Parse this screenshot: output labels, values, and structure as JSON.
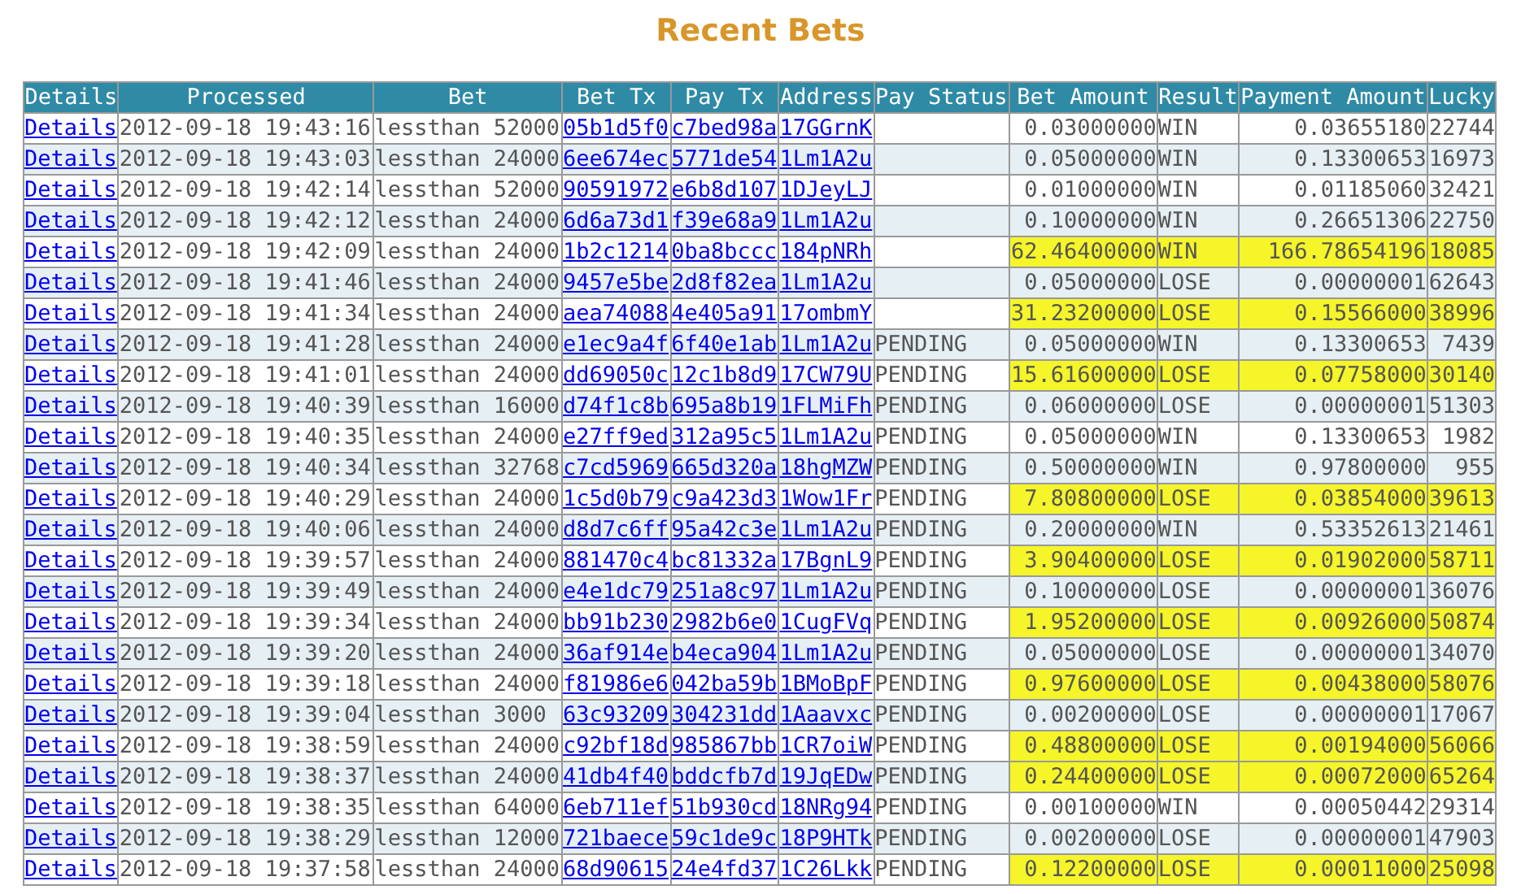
{
  "title": "Recent Bets",
  "table": {
    "columns": [
      "Details",
      "Processed",
      "Bet",
      "Bet Tx",
      "Pay Tx",
      "Address",
      "Pay Status",
      "Bet Amount",
      "Result",
      "Payment Amount",
      "Lucky"
    ],
    "rows": [
      {
        "details": "Details",
        "processed": "2012-09-18 19:43:16",
        "bet": "lessthan 52000",
        "bet_tx": "05b1d5f0",
        "pay_tx": "c7bed98a",
        "address": "17GGrnK",
        "pay_status": "",
        "bet_amount": "0.03000000",
        "result": "WIN",
        "payment_amount": "0.03655180",
        "lucky": "22744",
        "highlighted": false
      },
      {
        "details": "Details",
        "processed": "2012-09-18 19:43:03",
        "bet": "lessthan 24000",
        "bet_tx": "6ee674ec",
        "pay_tx": "5771de54",
        "address": "1Lm1A2u",
        "pay_status": "",
        "bet_amount": "0.05000000",
        "result": "WIN",
        "payment_amount": "0.13300653",
        "lucky": "16973",
        "highlighted": false
      },
      {
        "details": "Details",
        "processed": "2012-09-18 19:42:14",
        "bet": "lessthan 52000",
        "bet_tx": "90591972",
        "pay_tx": "e6b8d107",
        "address": "1DJeyLJ",
        "pay_status": "",
        "bet_amount": "0.01000000",
        "result": "WIN",
        "payment_amount": "0.01185060",
        "lucky": "32421",
        "highlighted": false
      },
      {
        "details": "Details",
        "processed": "2012-09-18 19:42:12",
        "bet": "lessthan 24000",
        "bet_tx": "6d6a73d1",
        "pay_tx": "f39e68a9",
        "address": "1Lm1A2u",
        "pay_status": "",
        "bet_amount": "0.10000000",
        "result": "WIN",
        "payment_amount": "0.26651306",
        "lucky": "22750",
        "highlighted": false
      },
      {
        "details": "Details",
        "processed": "2012-09-18 19:42:09",
        "bet": "lessthan 24000",
        "bet_tx": "1b2c1214",
        "pay_tx": "0ba8bccc",
        "address": "184pNRh",
        "pay_status": "",
        "bet_amount": "62.46400000",
        "result": "WIN",
        "payment_amount": "166.78654196",
        "lucky": "18085",
        "highlighted": true
      },
      {
        "details": "Details",
        "processed": "2012-09-18 19:41:46",
        "bet": "lessthan 24000",
        "bet_tx": "9457e5be",
        "pay_tx": "2d8f82ea",
        "address": "1Lm1A2u",
        "pay_status": "",
        "bet_amount": "0.05000000",
        "result": "LOSE",
        "payment_amount": "0.00000001",
        "lucky": "62643",
        "highlighted": false
      },
      {
        "details": "Details",
        "processed": "2012-09-18 19:41:34",
        "bet": "lessthan 24000",
        "bet_tx": "aea74088",
        "pay_tx": "4e405a91",
        "address": "17ombmY",
        "pay_status": "",
        "bet_amount": "31.23200000",
        "result": "LOSE",
        "payment_amount": "0.15566000",
        "lucky": "38996",
        "highlighted": true
      },
      {
        "details": "Details",
        "processed": "2012-09-18 19:41:28",
        "bet": "lessthan 24000",
        "bet_tx": "e1ec9a4f",
        "pay_tx": "6f40e1ab",
        "address": "1Lm1A2u",
        "pay_status": "PENDING",
        "bet_amount": "0.05000000",
        "result": "WIN",
        "payment_amount": "0.13300653",
        "lucky": "7439",
        "highlighted": false
      },
      {
        "details": "Details",
        "processed": "2012-09-18 19:41:01",
        "bet": "lessthan 24000",
        "bet_tx": "dd69050c",
        "pay_tx": "12c1b8d9",
        "address": "17CW79U",
        "pay_status": "PENDING",
        "bet_amount": "15.61600000",
        "result": "LOSE",
        "payment_amount": "0.07758000",
        "lucky": "30140",
        "highlighted": true
      },
      {
        "details": "Details",
        "processed": "2012-09-18 19:40:39",
        "bet": "lessthan 16000",
        "bet_tx": "d74f1c8b",
        "pay_tx": "695a8b19",
        "address": "1FLMiFh",
        "pay_status": "PENDING",
        "bet_amount": "0.06000000",
        "result": "LOSE",
        "payment_amount": "0.00000001",
        "lucky": "51303",
        "highlighted": false
      },
      {
        "details": "Details",
        "processed": "2012-09-18 19:40:35",
        "bet": "lessthan 24000",
        "bet_tx": "e27ff9ed",
        "pay_tx": "312a95c5",
        "address": "1Lm1A2u",
        "pay_status": "PENDING",
        "bet_amount": "0.05000000",
        "result": "WIN",
        "payment_amount": "0.13300653",
        "lucky": "1982",
        "highlighted": false
      },
      {
        "details": "Details",
        "processed": "2012-09-18 19:40:34",
        "bet": "lessthan 32768",
        "bet_tx": "c7cd5969",
        "pay_tx": "665d320a",
        "address": "18hgMZW",
        "pay_status": "PENDING",
        "bet_amount": "0.50000000",
        "result": "WIN",
        "payment_amount": "0.97800000",
        "lucky": "955",
        "highlighted": false
      },
      {
        "details": "Details",
        "processed": "2012-09-18 19:40:29",
        "bet": "lessthan 24000",
        "bet_tx": "1c5d0b79",
        "pay_tx": "c9a423d3",
        "address": "1Wow1Fr",
        "pay_status": "PENDING",
        "bet_amount": "7.80800000",
        "result": "LOSE",
        "payment_amount": "0.03854000",
        "lucky": "39613",
        "highlighted": true
      },
      {
        "details": "Details",
        "processed": "2012-09-18 19:40:06",
        "bet": "lessthan 24000",
        "bet_tx": "d8d7c6ff",
        "pay_tx": "95a42c3e",
        "address": "1Lm1A2u",
        "pay_status": "PENDING",
        "bet_amount": "0.20000000",
        "result": "WIN",
        "payment_amount": "0.53352613",
        "lucky": "21461",
        "highlighted": false
      },
      {
        "details": "Details",
        "processed": "2012-09-18 19:39:57",
        "bet": "lessthan 24000",
        "bet_tx": "881470c4",
        "pay_tx": "bc81332a",
        "address": "17BgnL9",
        "pay_status": "PENDING",
        "bet_amount": "3.90400000",
        "result": "LOSE",
        "payment_amount": "0.01902000",
        "lucky": "58711",
        "highlighted": true
      },
      {
        "details": "Details",
        "processed": "2012-09-18 19:39:49",
        "bet": "lessthan 24000",
        "bet_tx": "e4e1dc79",
        "pay_tx": "251a8c97",
        "address": "1Lm1A2u",
        "pay_status": "PENDING",
        "bet_amount": "0.10000000",
        "result": "LOSE",
        "payment_amount": "0.00000001",
        "lucky": "36076",
        "highlighted": false
      },
      {
        "details": "Details",
        "processed": "2012-09-18 19:39:34",
        "bet": "lessthan 24000",
        "bet_tx": "bb91b230",
        "pay_tx": "2982b6e0",
        "address": "1CugFVq",
        "pay_status": "PENDING",
        "bet_amount": "1.95200000",
        "result": "LOSE",
        "payment_amount": "0.00926000",
        "lucky": "50874",
        "highlighted": true
      },
      {
        "details": "Details",
        "processed": "2012-09-18 19:39:20",
        "bet": "lessthan 24000",
        "bet_tx": "36af914e",
        "pay_tx": "b4eca904",
        "address": "1Lm1A2u",
        "pay_status": "PENDING",
        "bet_amount": "0.05000000",
        "result": "LOSE",
        "payment_amount": "0.00000001",
        "lucky": "34070",
        "highlighted": false
      },
      {
        "details": "Details",
        "processed": "2012-09-18 19:39:18",
        "bet": "lessthan 24000",
        "bet_tx": "f81986e6",
        "pay_tx": "042ba59b",
        "address": "1BMoBpF",
        "pay_status": "PENDING",
        "bet_amount": "0.97600000",
        "result": "LOSE",
        "payment_amount": "0.00438000",
        "lucky": "58076",
        "highlighted": true
      },
      {
        "details": "Details",
        "processed": "2012-09-18 19:39:04",
        "bet": "lessthan 3000",
        "bet_tx": "63c93209",
        "pay_tx": "304231dd",
        "address": "1Aaavxc",
        "pay_status": "PENDING",
        "bet_amount": "0.00200000",
        "result": "LOSE",
        "payment_amount": "0.00000001",
        "lucky": "17067",
        "highlighted": false
      },
      {
        "details": "Details",
        "processed": "2012-09-18 19:38:59",
        "bet": "lessthan 24000",
        "bet_tx": "c92bf18d",
        "pay_tx": "985867bb",
        "address": "1CR7oiW",
        "pay_status": "PENDING",
        "bet_amount": "0.48800000",
        "result": "LOSE",
        "payment_amount": "0.00194000",
        "lucky": "56066",
        "highlighted": true
      },
      {
        "details": "Details",
        "processed": "2012-09-18 19:38:37",
        "bet": "lessthan 24000",
        "bet_tx": "41db4f40",
        "pay_tx": "bddcfb7d",
        "address": "19JqEDw",
        "pay_status": "PENDING",
        "bet_amount": "0.24400000",
        "result": "LOSE",
        "payment_amount": "0.00072000",
        "lucky": "65264",
        "highlighted": true
      },
      {
        "details": "Details",
        "processed": "2012-09-18 19:38:35",
        "bet": "lessthan 64000",
        "bet_tx": "6eb711ef",
        "pay_tx": "51b930cd",
        "address": "18NRg94",
        "pay_status": "PENDING",
        "bet_amount": "0.00100000",
        "result": "WIN",
        "payment_amount": "0.00050442",
        "lucky": "29314",
        "highlighted": false
      },
      {
        "details": "Details",
        "processed": "2012-09-18 19:38:29",
        "bet": "lessthan 12000",
        "bet_tx": "721baece",
        "pay_tx": "59c1de9c",
        "address": "18P9HTk",
        "pay_status": "PENDING",
        "bet_amount": "0.00200000",
        "result": "LOSE",
        "payment_amount": "0.00000001",
        "lucky": "47903",
        "highlighted": false
      },
      {
        "details": "Details",
        "processed": "2012-09-18 19:37:58",
        "bet": "lessthan 24000",
        "bet_tx": "68d90615",
        "pay_tx": "24e4fd37",
        "address": "1C26Lkk",
        "pay_status": "PENDING",
        "bet_amount": "0.12200000",
        "result": "LOSE",
        "payment_amount": "0.00011000",
        "lucky": "25098",
        "highlighted": true
      }
    ]
  }
}
